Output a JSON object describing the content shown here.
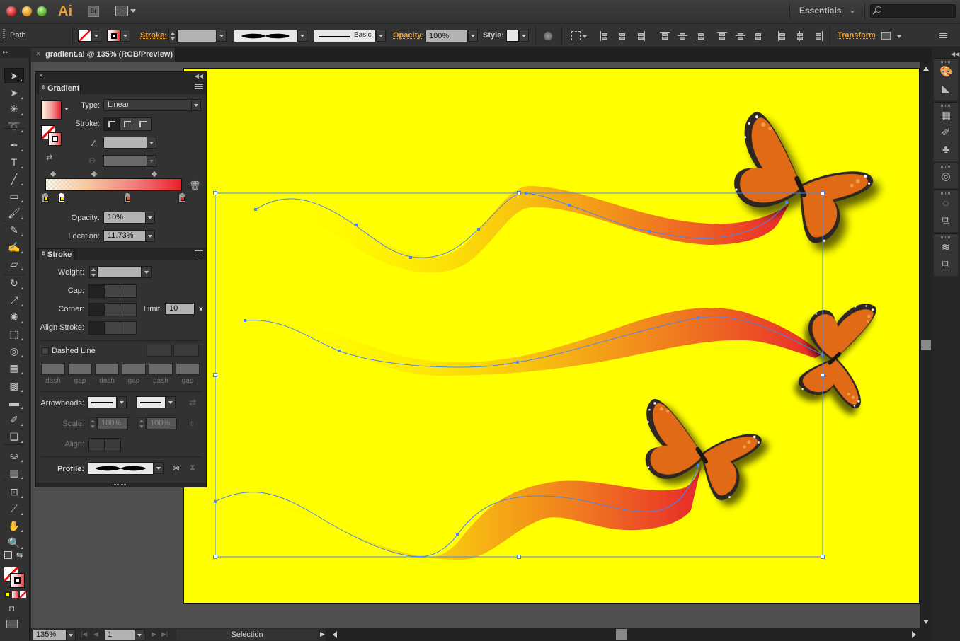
{
  "app": {
    "logo": "Ai",
    "bridge_label": "Br",
    "workspace": "Essentials",
    "search_placeholder": ""
  },
  "controlbar": {
    "selection_type": "Path",
    "stroke_label": "Stroke:",
    "stroke_weight": "",
    "variable_width_profile": "uniform-pinched",
    "brush_label": "Basic",
    "opacity_label": "Opacity:",
    "opacity_value": "100%",
    "style_label": "Style:",
    "transform_label": "Transform",
    "align_icons": [
      "horizontal-align-left-icon",
      "horizontal-align-center-icon",
      "horizontal-align-right-icon",
      "vertical-align-top-icon",
      "vertical-align-center-icon",
      "vertical-align-bottom-icon",
      "vertical-distribute-top-icon",
      "vertical-distribute-center-icon",
      "vertical-distribute-bottom-icon",
      "horizontal-distribute-left-icon",
      "horizontal-distribute-center-icon",
      "horizontal-distribute-right-icon"
    ]
  },
  "document": {
    "tab_title": "gradient.ai @ 135% (RGB/Preview)",
    "close_glyph": "×"
  },
  "tools": [
    {
      "name": "selection-tool",
      "glyph": "➤",
      "active": true
    },
    {
      "name": "direct-selection-tool",
      "glyph": "➤"
    },
    {
      "name": "magic-wand-tool",
      "glyph": "✳"
    },
    {
      "name": "lasso-tool",
      "glyph": "➰"
    },
    {
      "name": "pen-tool",
      "glyph": "✒"
    },
    {
      "name": "type-tool",
      "glyph": "T"
    },
    {
      "name": "line-segment-tool",
      "glyph": "╱"
    },
    {
      "name": "rectangle-tool",
      "glyph": "▭"
    },
    {
      "name": "paintbrush-tool",
      "glyph": "🖌"
    },
    {
      "name": "pencil-tool",
      "glyph": "✎"
    },
    {
      "name": "blob-brush-tool",
      "glyph": "✍"
    },
    {
      "name": "eraser-tool",
      "glyph": "▱"
    },
    {
      "name": "rotate-tool",
      "glyph": "↻"
    },
    {
      "name": "scale-tool",
      "glyph": "⤢"
    },
    {
      "name": "warp-tool",
      "glyph": "✺"
    },
    {
      "name": "free-transform-tool",
      "glyph": "⬚"
    },
    {
      "name": "shape-builder-tool",
      "glyph": "◎"
    },
    {
      "name": "perspective-grid-tool",
      "glyph": "▦"
    },
    {
      "name": "mesh-tool",
      "glyph": "▩"
    },
    {
      "name": "gradient-tool",
      "glyph": "▬"
    },
    {
      "name": "eyedropper-tool",
      "glyph": "✐"
    },
    {
      "name": "blend-tool",
      "glyph": "❏"
    },
    {
      "name": "symbol-sprayer-tool",
      "glyph": "⛀"
    },
    {
      "name": "column-graph-tool",
      "glyph": "▥"
    },
    {
      "name": "artboard-tool",
      "glyph": "⊡"
    },
    {
      "name": "slice-tool",
      "glyph": "⟋"
    },
    {
      "name": "hand-tool",
      "glyph": "✋"
    },
    {
      "name": "zoom-tool",
      "glyph": "🔍"
    }
  ],
  "statusbar": {
    "zoom": "135%",
    "artboard_number": "1",
    "mode": "Selection"
  },
  "gradient_panel": {
    "title": "Gradient",
    "type_label": "Type:",
    "type_value": "Linear",
    "stroke_label": "Stroke:",
    "angle_value": "",
    "aspect_value": "",
    "stops": [
      {
        "location_pct": 0,
        "color": "#ffe600"
      },
      {
        "location_pct": 11.73,
        "color": "#ffe600",
        "selected": true
      },
      {
        "location_pct": 60,
        "color": "#f05a22"
      },
      {
        "location_pct": 100,
        "color": "#e8202a"
      }
    ],
    "opacity_label": "Opacity:",
    "opacity_value": "10%",
    "location_label": "Location:",
    "location_value": "11.73%"
  },
  "stroke_panel": {
    "title": "Stroke",
    "weight_label": "Weight:",
    "weight_value": "",
    "cap_label": "Cap:",
    "corner_label": "Corner:",
    "limit_label": "Limit:",
    "limit_value": "10",
    "limit_unit": "x",
    "align_label": "Align Stroke:",
    "dashed_label": "Dashed Line",
    "dashed_checked": false,
    "dash_labels": [
      "dash",
      "gap",
      "dash",
      "gap",
      "dash",
      "gap"
    ],
    "arrowheads_label": "Arrowheads:",
    "scale_label": "Scale:",
    "scale_start": "100%",
    "scale_end": "100%",
    "align_arrow_label": "Align:",
    "profile_label": "Profile:"
  },
  "canvas": {
    "artboard_color": "#ffff00",
    "gradient_colors": [
      "#ffff00",
      "#f8b814",
      "#f07820",
      "#e82a2a"
    ],
    "selection_color": "#4a86f0"
  },
  "right_dock": {
    "groups": [
      [
        "color-icon",
        "color-guide-icon"
      ],
      [
        "swatches-icon",
        "brushes-icon",
        "symbols-icon"
      ],
      [
        "transparency-icon"
      ],
      [
        "appearance-icon",
        "graphic-styles-icon"
      ],
      [
        "layers-icon",
        "artboards-icon"
      ]
    ]
  }
}
